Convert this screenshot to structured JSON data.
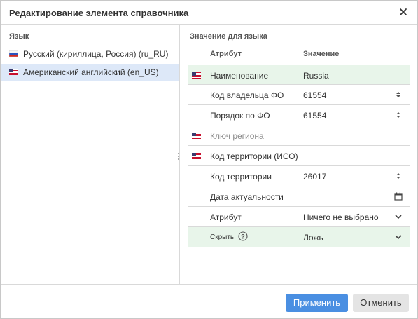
{
  "dialog": {
    "title": "Редактирование элемента справочника",
    "close_icon": "close-icon"
  },
  "left_panel": {
    "title": "Язык",
    "items": [
      {
        "label": "Русский (кириллица, Россия) (ru_RU)",
        "flag": "ru-flag-icon",
        "selected": false
      },
      {
        "label": "Американский английский (en_US)",
        "flag": "us-flag-icon",
        "selected": true
      }
    ]
  },
  "right_panel": {
    "title": "Значение для языка",
    "columns": {
      "attribute": "Атрибут",
      "value": "Значение"
    },
    "rows": [
      {
        "attr": "Наименование",
        "value": "Russia",
        "flag": true,
        "highlighted": true,
        "control": ""
      },
      {
        "attr": "Код владельца ФО",
        "value": "61554",
        "flag": false,
        "highlighted": false,
        "control": "stepper-icon"
      },
      {
        "attr": "Порядок по ФО",
        "value": "61554",
        "flag": false,
        "highlighted": false,
        "control": "stepper-icon"
      },
      {
        "attr": "Ключ региона",
        "value": "",
        "flag": true,
        "highlighted": false,
        "muted": true,
        "control": ""
      },
      {
        "attr": "Код территории (ИСО)",
        "value": "",
        "flag": true,
        "highlighted": false,
        "control": ""
      },
      {
        "attr": "Код территории",
        "value": "26017",
        "flag": false,
        "highlighted": false,
        "control": "stepper-icon"
      },
      {
        "attr": "Дата актуальности",
        "value": "",
        "flag": false,
        "highlighted": false,
        "control": "calendar-icon"
      },
      {
        "attr": "Атрибут",
        "value": "Ничего не выбрано",
        "flag": false,
        "highlighted": false,
        "control": "chevron-down-icon"
      },
      {
        "attr": "Скрыть",
        "value": "Ложь",
        "flag": false,
        "highlighted": true,
        "small": true,
        "help": true,
        "control": "chevron-down-icon"
      }
    ]
  },
  "footer": {
    "apply_label": "Применить",
    "cancel_label": "Отменить"
  },
  "colors": {
    "primary": "#4a8fe2",
    "selected_row": "#dde8f8",
    "highlight_row": "#e8f5ea"
  }
}
